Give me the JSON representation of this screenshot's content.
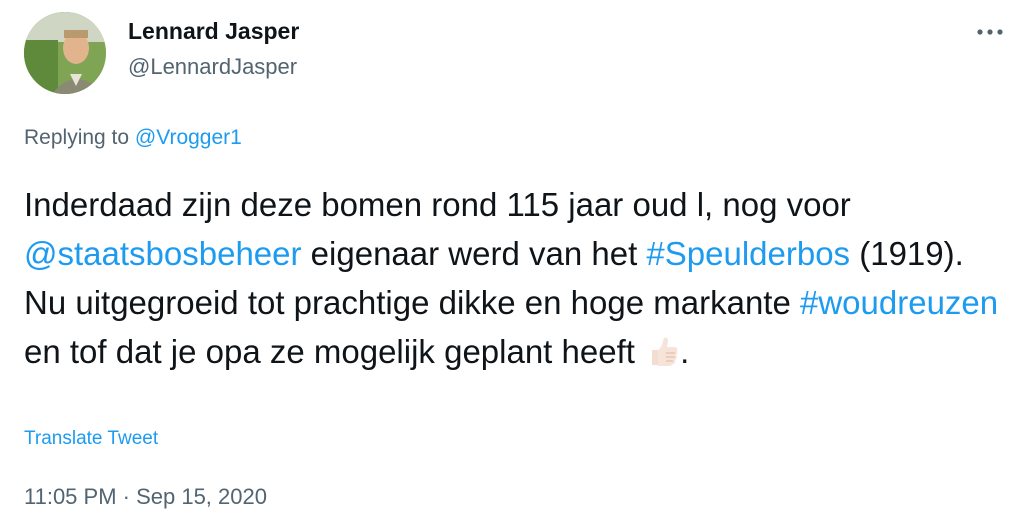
{
  "author": {
    "name": "Lennard Jasper",
    "handle": "@LennardJasper"
  },
  "reply": {
    "prefix": "Replying to ",
    "to": "@Vrogger1"
  },
  "tweet": {
    "t1": "Inderdaad zijn deze bomen rond 115 jaar oud l, nog voor ",
    "mention": "@staatsbosbeheer",
    "t2": " eigenaar werd van het ",
    "hashtag1": "#Speulderbos",
    "t3": " (1919). Nu uitgegroeid tot prachtige dikke en hoge markante ",
    "hashtag2": "#woudreuzen",
    "t4": " en tof dat je opa ze mogelijk geplant heeft ",
    "t5": ".",
    "emoji": "thumbs-up-icon"
  },
  "translate_label": "Translate Tweet",
  "timestamp": "11:05 PM · Sep 15, 2020",
  "colors": {
    "text": "#0f1419",
    "secondary": "#536471",
    "link": "#1d9bf0"
  }
}
